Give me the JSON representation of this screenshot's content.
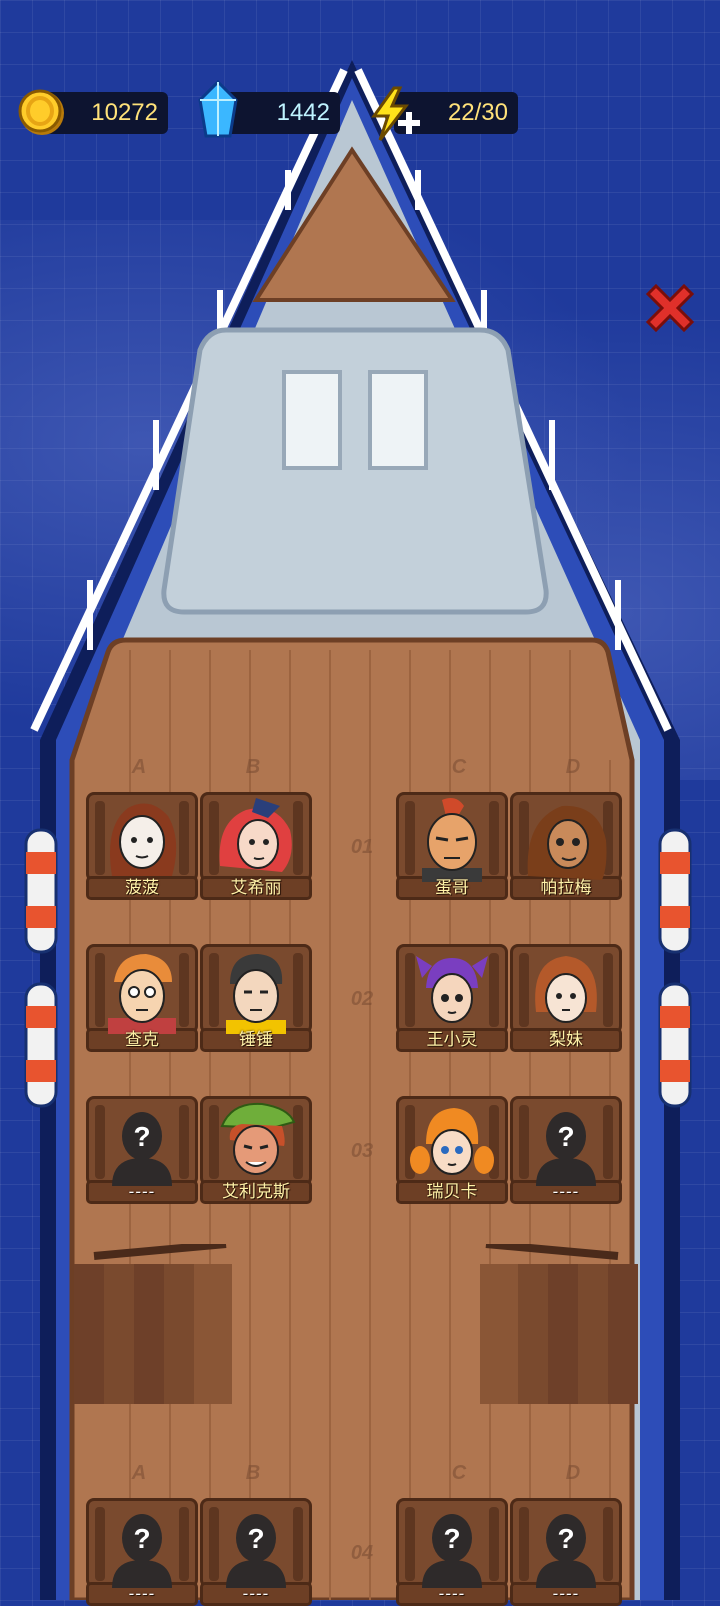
{
  "hud": {
    "gold": "10272",
    "gems": "1442",
    "energy": "22/30"
  },
  "colors": {
    "sea": "#1f3a9c",
    "deck": "#b07650",
    "hull": "#b9c7d3",
    "gold_text": "#ffe27a",
    "name_text": "#fff2a8",
    "close": "#e0302a"
  },
  "icons": {
    "gold": "gold-coin-icon",
    "gems": "blue-crystal-icon",
    "energy": "lightning-plus-icon",
    "close": "close-x-icon",
    "locked": "question-silhouette-icon"
  },
  "columns_top": [
    "A",
    "B",
    "C",
    "D"
  ],
  "columns_bottom": [
    "A",
    "B",
    "C",
    "D"
  ],
  "rows": [
    {
      "num": "01",
      "seats": [
        {
          "name": "菠菠",
          "locked": false,
          "look": "brunette-woman"
        },
        {
          "name": "艾希丽",
          "locked": false,
          "look": "redhead-stewardess"
        },
        {
          "name": "蛋哥",
          "locked": false,
          "look": "mohawk-man"
        },
        {
          "name": "帕拉梅",
          "locked": false,
          "look": "curly-woman"
        }
      ]
    },
    {
      "num": "02",
      "seats": [
        {
          "name": "查克",
          "locked": false,
          "look": "orange-hair-man"
        },
        {
          "name": "锤锤",
          "locked": false,
          "look": "black-hair-boy"
        },
        {
          "name": "王小灵",
          "locked": false,
          "look": "purple-hair-girl"
        },
        {
          "name": "梨妹",
          "locked": false,
          "look": "bob-hair-girl"
        }
      ]
    },
    {
      "num": "03",
      "seats": [
        {
          "name": "----",
          "locked": true
        },
        {
          "name": "艾利克斯",
          "locked": false,
          "look": "green-cap-boy"
        },
        {
          "name": "瑞贝卡",
          "locked": false,
          "look": "pigtail-girl"
        },
        {
          "name": "----",
          "locked": true
        }
      ]
    },
    {
      "num": "04",
      "seats": [
        {
          "name": "----",
          "locked": true
        },
        {
          "name": "----",
          "locked": true
        },
        {
          "name": "----",
          "locked": true
        },
        {
          "name": "----",
          "locked": true
        }
      ]
    }
  ]
}
